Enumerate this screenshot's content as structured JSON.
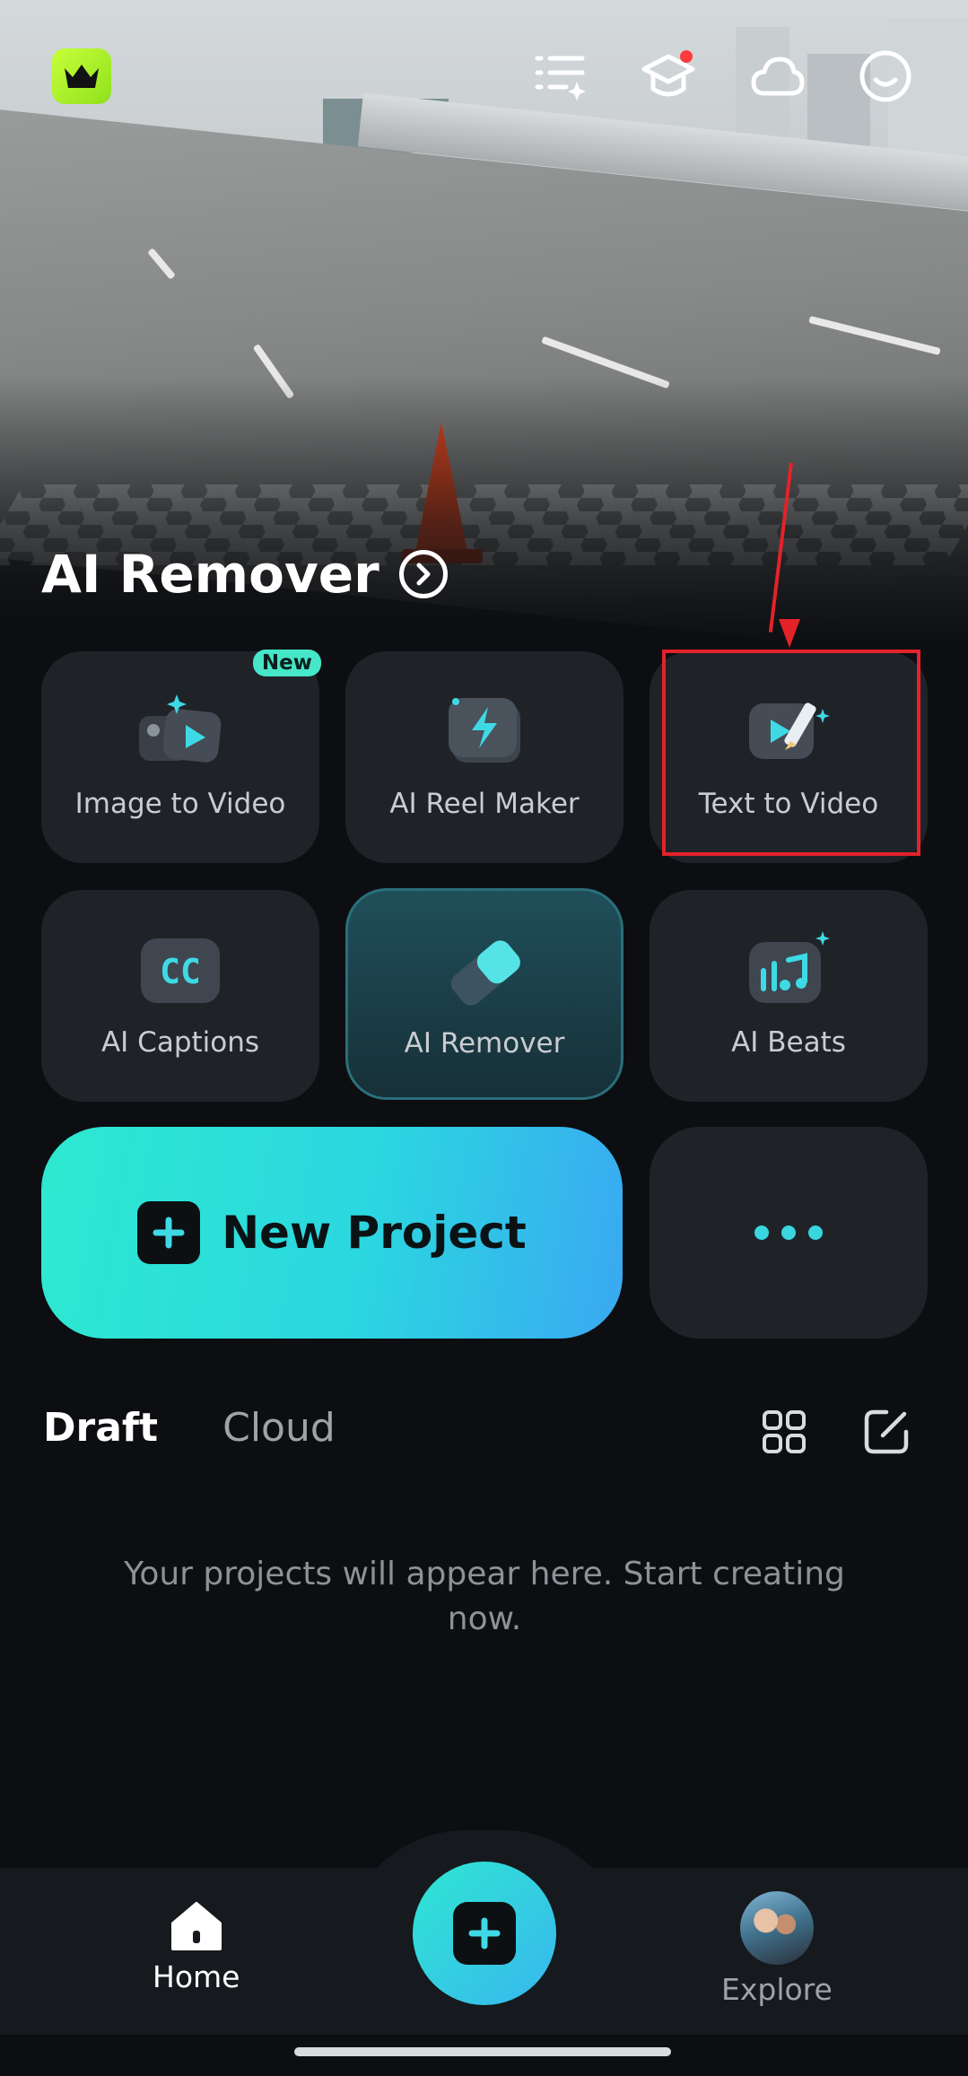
{
  "hero": {
    "title": "AI Remover"
  },
  "tiles": [
    {
      "label": "Image to Video",
      "badge": "New"
    },
    {
      "label": "AI Reel Maker"
    },
    {
      "label": "Text to Video"
    },
    {
      "label": "AI Captions"
    },
    {
      "label": "AI Remover"
    },
    {
      "label": "AI Beats"
    }
  ],
  "new_project": {
    "label": "New Project"
  },
  "tabs": {
    "draft": "Draft",
    "cloud": "Cloud"
  },
  "empty_state": "Your projects will appear here. Start creating now.",
  "nav": {
    "home": "Home",
    "explore": "Explore"
  },
  "colors": {
    "accent": "#39d6e0",
    "highlight": "#e3222a",
    "premium": "#a8f02a"
  }
}
